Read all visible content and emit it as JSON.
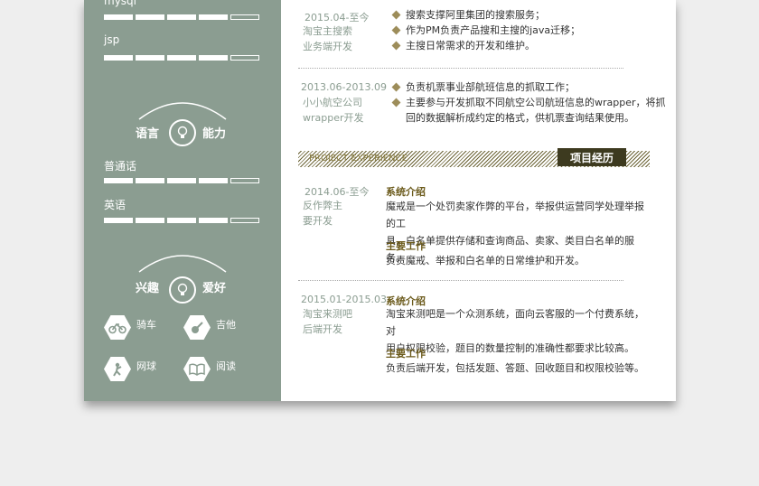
{
  "sidebar": {
    "skills": [
      {
        "label": "mysql",
        "level": 0.8
      },
      {
        "label": "jsp",
        "level": 0.8
      }
    ],
    "languages_title_left": "语言",
    "languages_title_right": "能力",
    "languages": [
      {
        "label": "普通话",
        "level": 0.8
      },
      {
        "label": "英语",
        "level": 0.8
      }
    ],
    "hobbies_title_left": "兴趣",
    "hobbies_title_right": "爱好",
    "hobbies": [
      {
        "label": "骑车",
        "icon": "bicycle-icon"
      },
      {
        "label": "吉他",
        "icon": "guitar-icon"
      },
      {
        "label": "网球",
        "icon": "tennis-icon"
      },
      {
        "label": "阅读",
        "icon": "book-icon"
      }
    ]
  },
  "work": [
    {
      "date": "2015.04-至今",
      "role_line1": "淘宝主搜索",
      "role_line2": "业务端开发",
      "bullets": [
        "搜索支撑阿里集团的搜索服务；",
        "作为PM负责产品搜和主搜的java迁移；",
        "主搜日常需求的开发和维护。"
      ]
    },
    {
      "date": "2013.06-2013.09",
      "role_line1": "小小航空公司",
      "role_line2": "wrapper开发",
      "bullets": [
        "负责机票事业部航班信息的抓取工作；",
        "主要参与开发抓取不同航空公司航班信息的wrapper，将抓",
        "回的数据解析成约定的格式，供机票查询结果使用。"
      ]
    }
  ],
  "section": {
    "en": "PROJECT EXPERIENCE",
    "cn": "项目经历"
  },
  "projects": [
    {
      "date": "2014.06-至今",
      "role_line1": "反作弊主",
      "role_line2": "要开发",
      "intro_title": "系统介绍",
      "intro_l1": "魔戒是一个处罚卖家作弊的平台，举报供运营同学处理举报的工",
      "intro_l2": "具，白名单提供存储和查询商品、卖家、类目白名单的服务。",
      "work_title": "主要工作",
      "work_text": "负责魔戒、举报和白名单的日常维护和开发。"
    },
    {
      "date": "2015.01-2015.03",
      "role_line1": "淘宝来测吧",
      "role_line2": "后端开发",
      "intro_title": "系统介绍",
      "intro_l1": "淘宝来测吧是一个众测系统，面向云客服的一个付费系统，对",
      "intro_l2": "用户权限校验，题目的数量控制的准确性都要求比较高。",
      "work_title": "主要工作",
      "work_text": "负责后端开发，包括发题、答题、回收题目和权限校验等。"
    }
  ],
  "colors": {
    "sidebar": "#8b9d91",
    "accent": "#3d3a1f",
    "diamond": "#9d8d5a"
  }
}
